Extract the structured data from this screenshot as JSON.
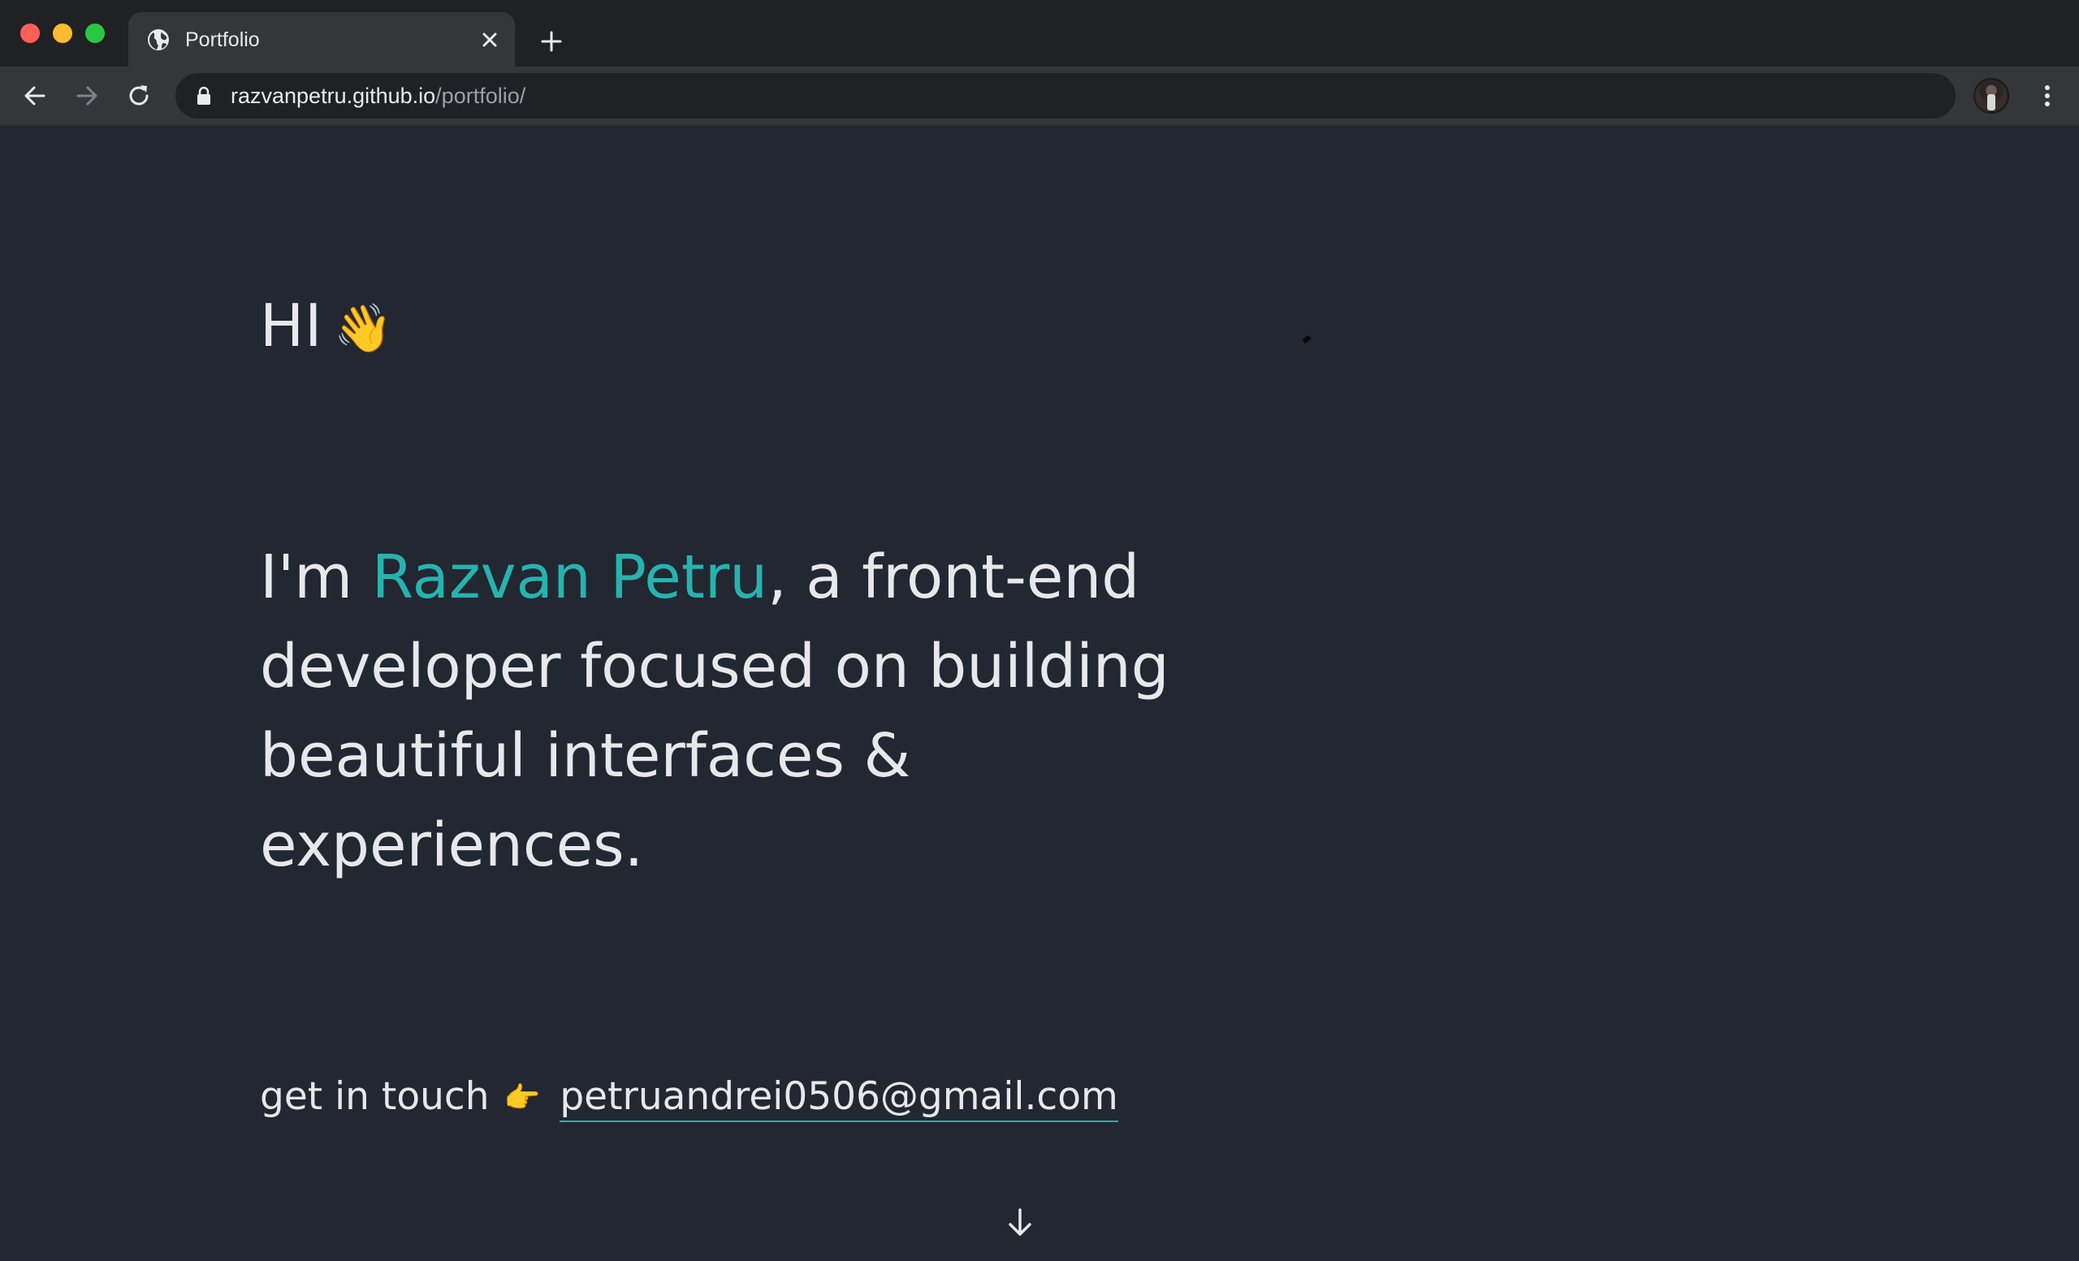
{
  "browser": {
    "tab": {
      "title": "Portfolio",
      "favicon": "globe-icon"
    },
    "address_bar": {
      "host": "razvanpetru.github.io",
      "path": "/portfolio/"
    }
  },
  "hero": {
    "greeting": "HI",
    "greeting_emoji": "👋",
    "intro_before_name": "I'm ",
    "name": "Razvan Petru",
    "intro_after_name": ", a front-end developer focused on building beautiful interfaces & experiences.",
    "contact_label": "get in touch",
    "contact_emoji": "👉",
    "email": "petruandrei0506@gmail.com"
  },
  "colors": {
    "page_background": "#222731",
    "accent": "#26b3b0",
    "text": "#e6e8ec"
  }
}
